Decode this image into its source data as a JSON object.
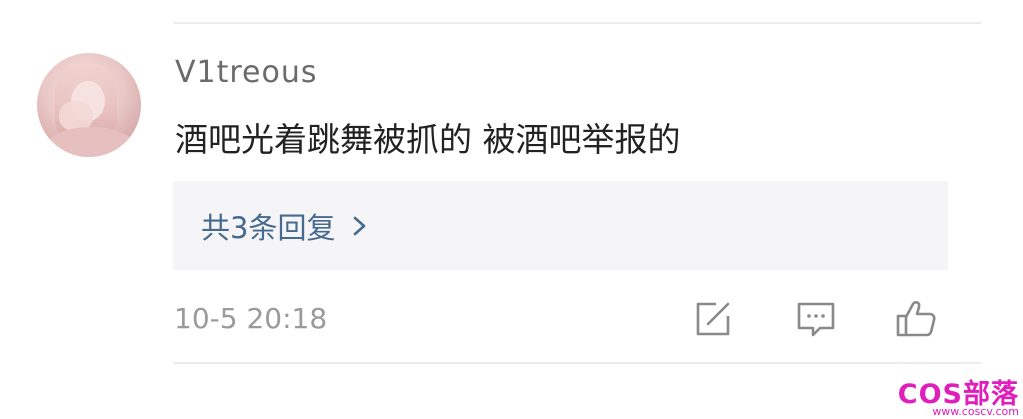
{
  "comment": {
    "username": "V1treous",
    "text": "酒吧光着跳舞被抓的 被酒吧举报的",
    "reply_link": "共3条回复",
    "timestamp": "10-5 20:18"
  },
  "actions": {
    "share_icon": "share-icon",
    "comment_icon": "comment-icon",
    "like_icon": "thumbs-up-icon"
  },
  "watermark": {
    "main": "COS部落",
    "url": "www.coscv.com"
  },
  "colors": {
    "username": "#6b6b6b",
    "comment_text": "#222222",
    "reply_link": "#46698f",
    "reply_box_bg": "#f5f5f7",
    "timestamp": "#9a9a9a",
    "icon_stroke": "#8a8a8a",
    "watermark": "#e01dbd"
  }
}
